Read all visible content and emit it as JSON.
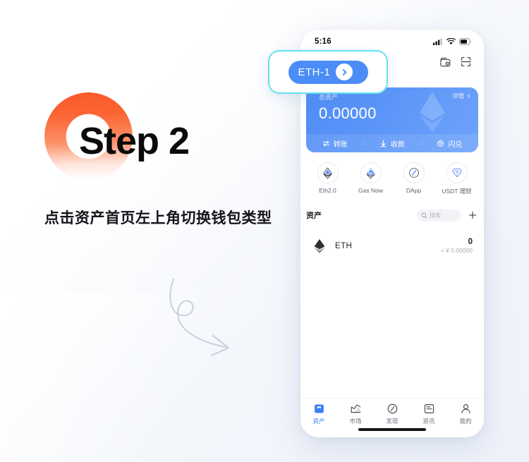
{
  "left": {
    "step_title": "Step 2",
    "description": "点击资产首页左上角切换钱包类型",
    "ring_color_top": "#fa5a2a",
    "ring_color_bottom": "#ffffff"
  },
  "callout": {
    "wallet_label": "ETH-1",
    "arrow_icon": "chevron-right-icon",
    "border_color": "#63e2f0",
    "pill_color": "#4b8cf7"
  },
  "phone": {
    "statusbar": {
      "time": "5:16",
      "icons": [
        "signal-icon",
        "wifi-icon",
        "battery-icon"
      ]
    },
    "header": {
      "icons": [
        "wallet-icon",
        "scan-icon"
      ]
    },
    "balance_card": {
      "sublabel": "总资产",
      "amount": "0.00000",
      "detail_label": "详情",
      "detail_arrow": "chevron-right-icon",
      "background_color": "#5b95f8",
      "actions": [
        {
          "label": "转账",
          "icon": "transfer-icon"
        },
        {
          "label": "收款",
          "icon": "receive-icon"
        },
        {
          "label": "闪兑",
          "icon": "swap-icon"
        }
      ]
    },
    "quick_actions": [
      {
        "label": "Eth2.0",
        "icon": "eth-stake-icon"
      },
      {
        "label": "Gas Now",
        "icon": "gas-icon"
      },
      {
        "label": "DApp",
        "icon": "compass-icon"
      },
      {
        "label": "USDT 理财",
        "icon": "usdt-finance-icon"
      }
    ],
    "assets": {
      "title": "资产",
      "search_placeholder": "搜索",
      "search_icon": "search-icon",
      "add_icon": "plus-icon",
      "rows": [
        {
          "icon": "eth-token-icon",
          "symbol": "ETH",
          "amount": "0",
          "fiat": "≈ ¥ 0.00000"
        }
      ]
    },
    "tabbar": {
      "active_color": "#3d7ff5",
      "items": [
        {
          "label": "资产",
          "icon": "wallet-tab-icon",
          "active": true
        },
        {
          "label": "市场",
          "icon": "market-tab-icon",
          "active": false
        },
        {
          "label": "发现",
          "icon": "discover-tab-icon",
          "active": false
        },
        {
          "label": "资讯",
          "icon": "news-tab-icon",
          "active": false
        },
        {
          "label": "我的",
          "icon": "profile-tab-icon",
          "active": false
        }
      ]
    }
  }
}
